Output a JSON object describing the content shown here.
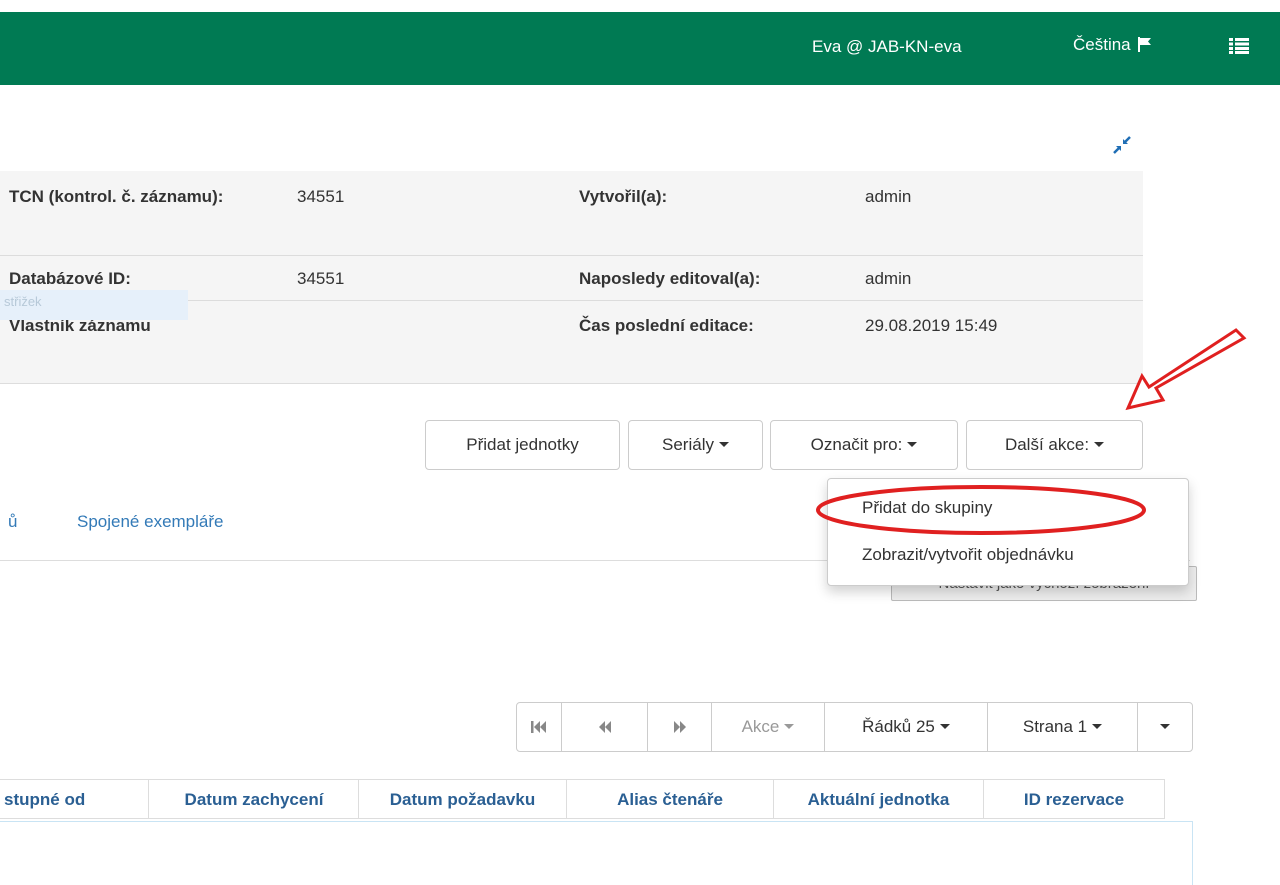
{
  "header": {
    "user": "Eva @ JAB-KN-eva",
    "language": "Čeština",
    "colors": {
      "bar": "#007a53",
      "text": "#ffffff"
    },
    "icons": [
      "flag-icon",
      "menu-list-icon"
    ]
  },
  "toolbar_icons": [
    "collapse-icon"
  ],
  "record_info": {
    "tcn_label": "TCN (kontrol. č. záznamu):",
    "tcn_value": "34551",
    "db_id_label": "Databázové ID:",
    "db_id_value": "34551",
    "owner_label": "Vlastník záznamu",
    "owner_ghost": "střižek",
    "created_by_label": "Vytvořil(a):",
    "created_by_value": "admin",
    "edited_by_label": "Naposledy editoval(a):",
    "edited_by_value": "admin",
    "edit_time_label": "Čas poslední editace:",
    "edit_time_value": "29.08.2019 15:49"
  },
  "actions": {
    "add_units": "Přidat jednotky",
    "serials": "Seriály",
    "mark_for": "Označit pro:",
    "more_actions": "Další akce:"
  },
  "more_actions_menu": {
    "items": [
      "Přidat do skupiny",
      "Zobrazit/vytvořit objednávku"
    ],
    "highlighted": "Přidat do skupiny",
    "annotation_color": "#e02020"
  },
  "tabs": {
    "partial": "ů",
    "linked_items": "Spojené exempláře"
  },
  "default_view_button": "Nastavit jako výchozí zobrazení",
  "pager": {
    "actions": "Akce",
    "rows": "Řádků 25",
    "page": "Strana 1"
  },
  "grid": {
    "columns": [
      "stupné od",
      "Datum zachycení",
      "Datum požadavku",
      "Alias čtenáře",
      "Aktuální jednotka",
      "ID rezervace"
    ]
  }
}
